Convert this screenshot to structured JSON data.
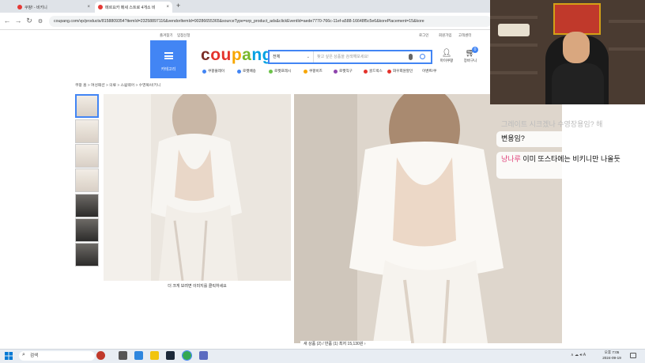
{
  "browser": {
    "tabs": [
      {
        "label": "쿠팡! - 비키니"
      },
      {
        "label": "메르요카 메세 스트로 4개소 비"
      }
    ],
    "new_tab": "+",
    "url": "coupang.com/vp/products/8158809354?itemId=23258897116&vendorItemId=90286655365&sourceType=srp_product_ads&clickEventId=aede7770-766c-11ef-a588-16648f5c5e6&korePlacement=15&kore"
  },
  "header": {
    "top_menu": [
      "즐겨찾기",
      "입점신청"
    ],
    "top_right_menu": [
      "로그인",
      "회원가입",
      "고객센터"
    ],
    "category_label": "카테고리",
    "logo": [
      "c",
      "ou",
      "p",
      "a",
      "ng"
    ],
    "search_select": "전체",
    "search_placeholder": "찾고 싶은 상품을 검색해보세요!",
    "my_label": "마이쿠팡",
    "cart_label": "장바구니",
    "cart_count": "0",
    "subnav": [
      "쿠팡플레이",
      "로켓배송",
      "로켓프레시",
      "쿠팡비즈",
      "로켓직구",
      "골드박스",
      "와우회원할인",
      "이벤트/쿠"
    ]
  },
  "breadcrumb": "쿠팡 홈 > 여성패션 > 의류 > 스윔웨어 > 수영복/비키니",
  "product": {
    "caption": "더 크게 보려면 이미지를 클릭하세요",
    "reviews": "새 상품 (2) / 반품 (1) 최저 15,130원 ›"
  },
  "chat": [
    {
      "nick": "",
      "text": "그레이트 시크겠나 수영장용임? 해"
    },
    {
      "nick": "",
      "text": "변용임?"
    },
    {
      "nick": "냥나루",
      "text": "이미 또스타에는 비키니만 나올듯"
    }
  ],
  "taskbar": {
    "search": "검색",
    "time": "오후 7:05",
    "date": "2024-09-19"
  },
  "colors": {
    "accent": "#4285f4",
    "nick": "#e0457b"
  }
}
